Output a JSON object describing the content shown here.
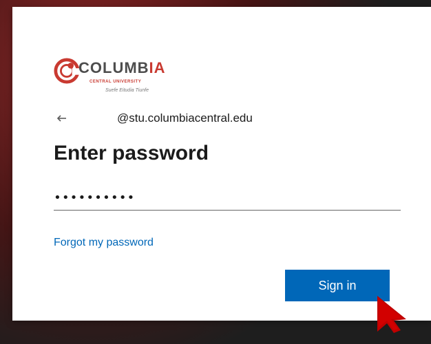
{
  "background": {
    "colors": [
      "#3b3b3b",
      "#6b1f1f",
      "#5a1b1b",
      "#2a2a2a"
    ]
  },
  "brand": {
    "logo": {
      "text_primary": "COLUMB",
      "text_accent": "IA",
      "subtitle": "CENTRAL UNIVERSITY",
      "motto": "Suefe Eitudia Tiunfe",
      "accent_color": "#c93a31",
      "text_color": "#4d4d4d"
    }
  },
  "identity": {
    "back_icon": "arrow-left-icon",
    "email": "@stu.columbiacentral.edu"
  },
  "form": {
    "title": "Enter password",
    "password_value": "••••••••••",
    "forgot_link": "Forgot my password",
    "sign_in_label": "Sign in",
    "accent_color": "#0067b8"
  },
  "overlay": {
    "cursor_icon": "red-arrow-cursor-icon",
    "cursor_color": "#c00000"
  }
}
